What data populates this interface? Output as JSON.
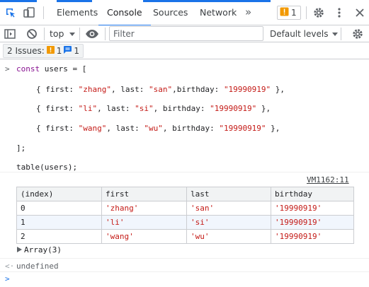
{
  "tabs": [
    {
      "label": "Elements"
    },
    {
      "label": "Console"
    },
    {
      "label": "Sources"
    },
    {
      "label": "Network"
    }
  ],
  "more_tabs": "»",
  "issues_count": "1",
  "toolbar": {
    "context": "top",
    "filter_placeholder": "Filter",
    "levels": "Default levels"
  },
  "issues_bar": {
    "label": "2 Issues:",
    "warning_count": "1",
    "info_count": "1"
  },
  "code": {
    "line1_kw": "const",
    "line1_rest": " users = [",
    "rows": [
      {
        "first": "\"zhang\"",
        "last": "\"san\"",
        "birthday": "\"19990919\"",
        "sep1": ", last: ",
        "sep2": ",birthday: "
      },
      {
        "first": "\"li\"",
        "last": "\"si\"",
        "birthday": "\"19990919\"",
        "sep1": ", last: ",
        "sep2": ", birthday: "
      },
      {
        "first": "\"wang\"",
        "last": "\"wu\"",
        "birthday": "\"19990919\"",
        "sep1": ", last: ",
        "sep2": ", birthday: "
      }
    ],
    "row_prefix": "{ first: ",
    "row_suffix": " },",
    "close": "];",
    "call": "table(users);"
  },
  "source_link": "VM1162:11",
  "table": {
    "headers": [
      "(index)",
      "first",
      "last",
      "birthday"
    ],
    "rows": [
      [
        "0",
        "'zhang'",
        "'san'",
        "'19990919'"
      ],
      [
        "1",
        "'li'",
        "'si'",
        "'19990919'"
      ],
      [
        "2",
        "'wang'",
        "'wu'",
        "'19990919'"
      ]
    ]
  },
  "array_label": "Array(3)",
  "result": "undefined",
  "colors": {
    "accent": "#1a73e8",
    "string": "#c41a16",
    "keyword": "#881391",
    "warning": "#f29900"
  }
}
